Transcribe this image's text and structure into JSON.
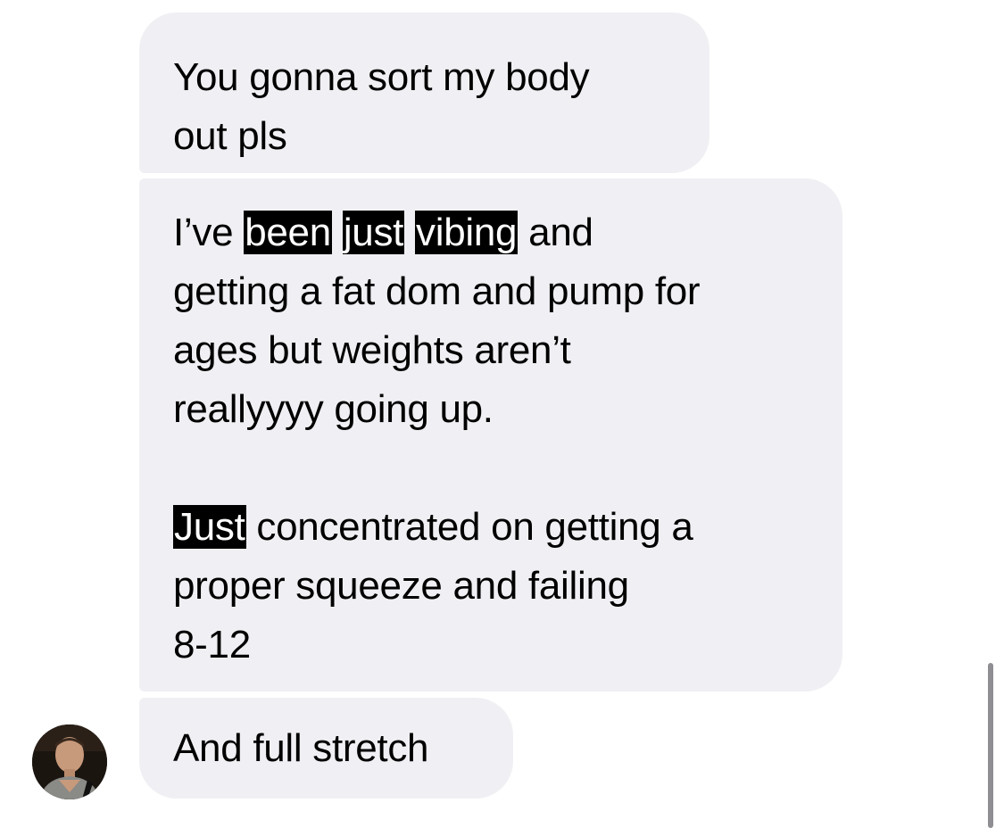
{
  "messages": [
    {
      "lines": [
        [
          {
            "t": "You gonna sort my body"
          }
        ],
        [
          {
            "t": "out pls"
          }
        ]
      ]
    },
    {
      "lines": [
        [
          {
            "t": "I’ve "
          },
          {
            "t": "been",
            "hl": true
          },
          {
            "t": " "
          },
          {
            "t": "just",
            "hl": true
          },
          {
            "t": " "
          },
          {
            "t": "vibing",
            "hl": true
          },
          {
            "t": " and"
          }
        ],
        [
          {
            "t": "getting a fat dom and pump for"
          }
        ],
        [
          {
            "t": "ages but weights aren’t"
          }
        ],
        [
          {
            "t": "reallyyyy going up."
          }
        ],
        [],
        [
          {
            "t": "Just",
            "hl": true
          },
          {
            "t": " concentrated on getting a"
          }
        ],
        [
          {
            "t": "proper squeeze and failing"
          }
        ],
        [
          {
            "t": "8-12"
          }
        ]
      ]
    },
    {
      "lines": [
        [
          {
            "t": "And full stretch"
          }
        ]
      ]
    }
  ],
  "colors": {
    "bubble_bg": "#f0f0f4",
    "highlight_bg": "#000000",
    "highlight_text": "#ffffff",
    "scrollbar": "#8e8e93"
  }
}
